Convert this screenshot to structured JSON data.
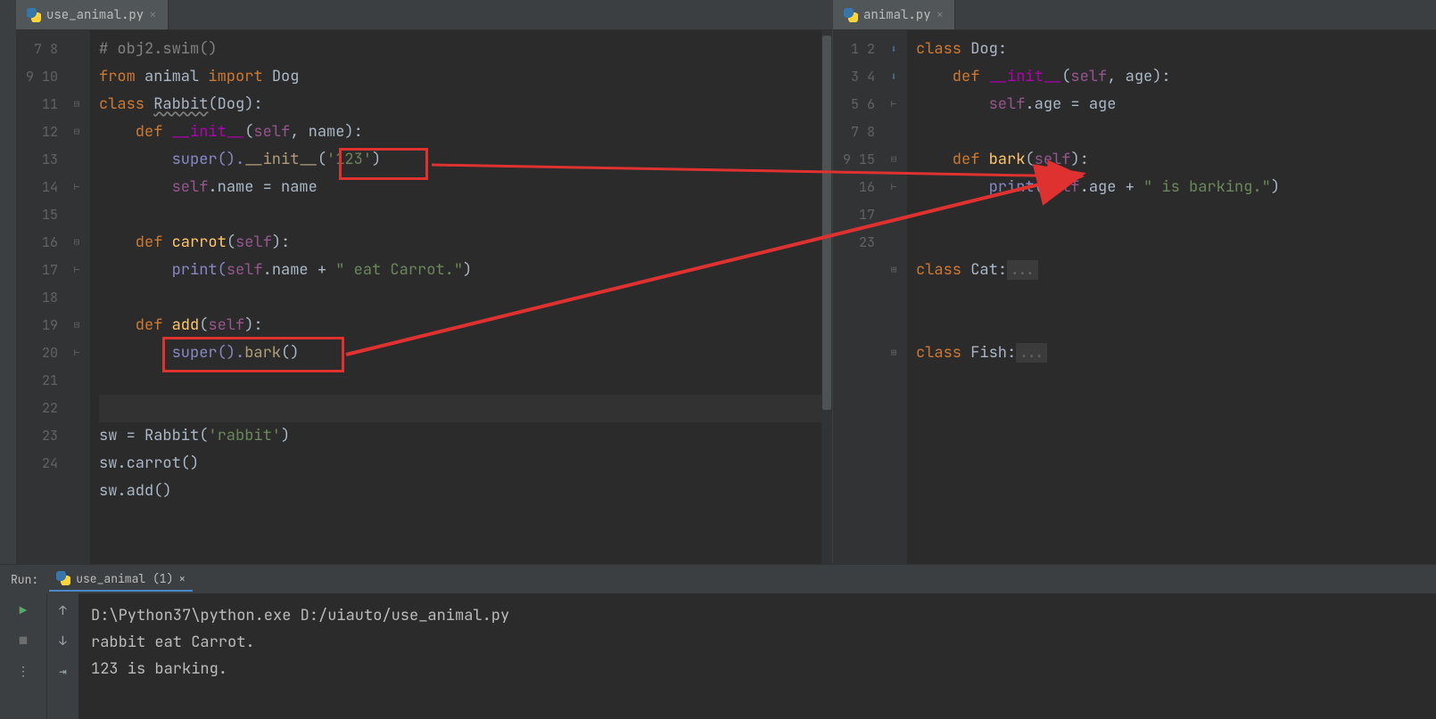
{
  "tabs": {
    "left": {
      "name": "use_animal.py"
    },
    "right": {
      "name": "animal.py"
    }
  },
  "left_editor": {
    "lines": [
      "7",
      "8",
      "9",
      "10",
      "11",
      "12",
      "13",
      "14",
      "15",
      "16",
      "17",
      "18",
      "19",
      "20",
      "21",
      "22",
      "23",
      "24"
    ],
    "l7": "# obj2.swim()",
    "l8a": "from ",
    "l8b": "animal ",
    "l8c": "import ",
    "l8d": "Dog",
    "l9a": "class ",
    "l9b": "Rabbit",
    "l9c": "(Dog):",
    "l10a": "    def ",
    "l10b": "__init__",
    "l10c": "(",
    "l10d": "self",
    "l10e": ", name):",
    "l11a": "        super().",
    "l11b": "__init__",
    "l11c": "(",
    "l11d": "'123'",
    "l11e": ")",
    "l12a": "        ",
    "l12b": "self",
    "l12c": ".name = name",
    "l14a": "    def ",
    "l14b": "carrot",
    "l14c": "(",
    "l14d": "self",
    "l14e": "):",
    "l15a": "        print(",
    "l15b": "self",
    "l15c": ".name + ",
    "l15d": "\" eat Carrot.\"",
    "l15e": ")",
    "l17a": "    def ",
    "l17b": "add",
    "l17c": "(",
    "l17d": "self",
    "l17e": "):",
    "l18a": "        super().",
    "l18b": "bark",
    "l18c": "()",
    "l21a": "sw = Rabbit(",
    "l21b": "'rabbit'",
    "l21c": ")",
    "l22": "sw.carrot()",
    "l23": "sw.add()"
  },
  "right_editor": {
    "lines": [
      "1",
      "2",
      "3",
      "4",
      "5",
      "6",
      "7",
      "8",
      "9",
      "15",
      "16",
      "17",
      "23"
    ],
    "r1a": "class ",
    "r1b": "Dog",
    "r1c": ":",
    "r2a": "    def ",
    "r2b": "__init__",
    "r2c": "(",
    "r2d": "self",
    "r2e": ", age):",
    "r3a": "        ",
    "r3b": "self",
    "r3c": ".age = age",
    "r5a": "    def ",
    "r5b": "bark",
    "r5c": "(",
    "r5d": "self",
    "r5e": "):",
    "r6a": "        print(",
    "r6b": "self",
    "r6c": ".age + ",
    "r6d": "\" is barking.\"",
    "r6e": ")",
    "r9a": "class ",
    "r9b": "Cat",
    "r9c": ":",
    "r9d": "...",
    "r17a": "class ",
    "r17b": "Fish",
    "r17c": ":",
    "r17d": "..."
  },
  "run": {
    "label": "Run:",
    "tab": "use_animal (1)",
    "out1": "D:\\Python37\\python.exe D:/uiauto/use_animal.py",
    "out2": "rabbit eat Carrot.",
    "out3": "123 is barking."
  }
}
